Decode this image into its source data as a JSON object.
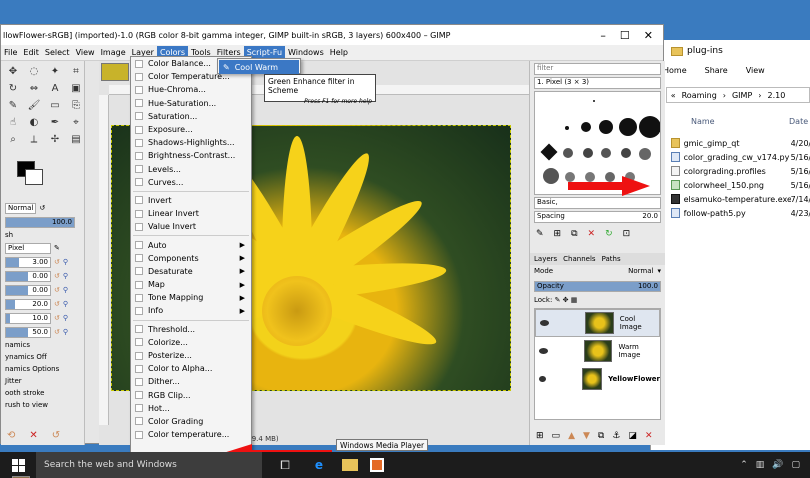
{
  "explorer": {
    "title": "plug-ins",
    "ribbon": [
      "Home",
      "Share",
      "View"
    ],
    "breadcrumb": [
      "Roaming",
      "GIMP",
      "2.10"
    ],
    "col_name": "Name",
    "col_date": "Date",
    "files": [
      {
        "name": "gmic_gimp_qt",
        "date": "4/20/",
        "type": "folder"
      },
      {
        "name": "color_grading_cw_v174.py",
        "date": "5/16/",
        "type": "py"
      },
      {
        "name": "colorgrading.profiles",
        "date": "5/16/",
        "type": "file"
      },
      {
        "name": "colorwheel_150.png",
        "date": "5/16/",
        "type": "png"
      },
      {
        "name": "elsamuko-temperature.exe",
        "date": "7/14/",
        "type": "exe"
      },
      {
        "name": "follow-path5.py",
        "date": "4/23/",
        "type": "py"
      }
    ]
  },
  "gimp": {
    "title": "llowFlower-sRGB] (imported)-1.0 (RGB color 8-bit gamma integer, GIMP built-in sRGB, 3 layers) 600x400 – GIMP",
    "menu": [
      "File",
      "Edit",
      "Select",
      "View",
      "Image",
      "Layer",
      "Colors",
      "Tools",
      "Filters",
      "Script-Fu",
      "Windows",
      "Help"
    ],
    "status": "(9.4 MB)"
  },
  "toolbox": {
    "mode": "Normal",
    "opacity": "100.0",
    "brush_label": "sh",
    "brush": "Pixel",
    "values": [
      "3.00",
      "0.00",
      "0.00",
      "20.0",
      "10.0",
      "50.0"
    ],
    "fill_pct": [
      0.3,
      0.5,
      0.5,
      0.2,
      0.1,
      0.5
    ],
    "labels": [
      "namics",
      "ynamics Off",
      "namics Options",
      "Jitter",
      "ooth stroke",
      "rush to view"
    ]
  },
  "colors_menu": {
    "items": [
      {
        "label": "Color Balance...",
        "sub": false
      },
      {
        "label": "Color Temperature...",
        "sub": false
      },
      {
        "label": "Hue-Chroma...",
        "sub": false
      },
      {
        "label": "Hue-Saturation...",
        "sub": false
      },
      {
        "label": "Saturation...",
        "sub": false
      },
      {
        "label": "Exposure...",
        "sub": false
      },
      {
        "label": "Shadows-Highlights...",
        "sub": false
      },
      {
        "label": "Brightness-Contrast...",
        "sub": false
      },
      {
        "label": "Levels...",
        "sub": false
      },
      {
        "label": "Curves...",
        "sub": false
      },
      {
        "sep": true
      },
      {
        "label": "Invert",
        "sub": false
      },
      {
        "label": "Linear Invert",
        "sub": false
      },
      {
        "label": "Value Invert",
        "sub": false
      },
      {
        "sep": true
      },
      {
        "label": "Auto",
        "sub": true
      },
      {
        "label": "Components",
        "sub": true
      },
      {
        "label": "Desaturate",
        "sub": true
      },
      {
        "label": "Map",
        "sub": true
      },
      {
        "label": "Tone Mapping",
        "sub": true
      },
      {
        "label": "Info",
        "sub": true
      },
      {
        "sep": true
      },
      {
        "label": "Threshold...",
        "sub": false
      },
      {
        "label": "Colorize...",
        "sub": false
      },
      {
        "label": "Posterize...",
        "sub": false
      },
      {
        "label": "Color to Alpha...",
        "sub": false
      },
      {
        "label": "Dither...",
        "sub": false
      },
      {
        "label": "RGB Clip...",
        "sub": false
      },
      {
        "label": "Hot...",
        "sub": false
      },
      {
        "label": "Color Grading",
        "sub": false
      },
      {
        "label": "Color temperature...",
        "sub": false
      }
    ]
  },
  "scriptfu_menu": {
    "item": "Cool Warm",
    "tooltip": "Green Enhance filter in Scheme",
    "tooltip_hint": "Press F1 for more help"
  },
  "dock": {
    "filter_placeholder": "filter",
    "brush_name": "1. Pixel (3 × 3)",
    "brush_set": "Basic,",
    "spacing_label": "Spacing",
    "spacing_value": "20.0",
    "tabs": [
      "Layers",
      "Channels",
      "Paths"
    ],
    "mode_label": "Mode",
    "mode": "Normal",
    "opacity_label": "Opacity",
    "opacity_value": "100.0",
    "lock_label": "Lock:",
    "layers": [
      {
        "name": "Cool Image",
        "bold": false
      },
      {
        "name": "Warm Image",
        "bold": false
      },
      {
        "name": "YellowFlower",
        "bold": true
      }
    ]
  },
  "taskbar": {
    "search": "Search the web and Windows",
    "media_tip": "Windows Media Player"
  },
  "colors": {
    "accent": "#3b78c5",
    "arrow": "#ee1111",
    "taskbar": "#1c1c1c"
  }
}
